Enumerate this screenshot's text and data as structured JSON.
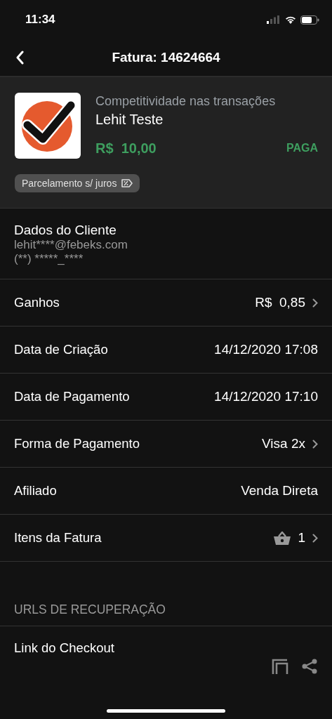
{
  "status_bar": {
    "time": "11:34"
  },
  "nav": {
    "title": "Fatura: 14624664"
  },
  "invoice": {
    "product": "Competitividade nas transações",
    "seller": "Lehit Teste",
    "amount": "R$  10,00",
    "status": "PAGA",
    "tag": "Parcelamento s/ juros"
  },
  "customer": {
    "title": "Dados do Cliente",
    "email": "lehit****@febeks.com",
    "phone": "(**) *****_****"
  },
  "rows": [
    {
      "kind": "nav",
      "label": "Ganhos",
      "value": "R$  0,85"
    },
    {
      "kind": "plain",
      "label": "Data de Criação",
      "value": "14/12/2020 17:08"
    },
    {
      "kind": "plain",
      "label": "Data de Pagamento",
      "value": "14/12/2020 17:10"
    },
    {
      "kind": "nav",
      "label": "Forma de Pagamento",
      "value": "Visa 2x"
    },
    {
      "kind": "plain",
      "label": "Afiliado",
      "value": "Venda Direta"
    },
    {
      "kind": "items",
      "label": "Itens da Fatura",
      "value": "1"
    }
  ],
  "recovery": {
    "header": "URLS DE RECUPERAÇÃO",
    "link_label": "Link do Checkout"
  }
}
